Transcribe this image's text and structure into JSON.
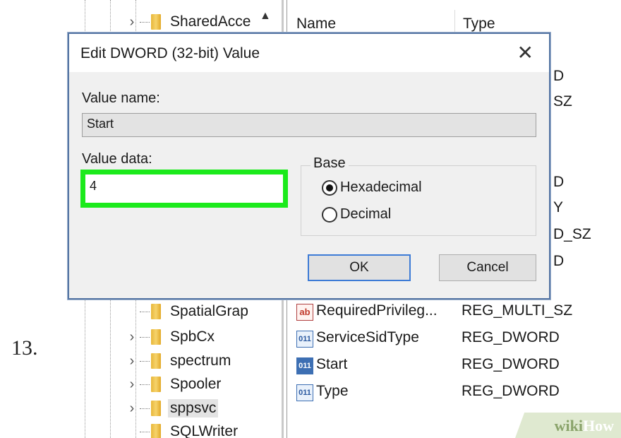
{
  "step_number": "13.",
  "tree": {
    "items": [
      {
        "label": "SharedAcce",
        "has_expander": true
      },
      {
        "label": "SpatialGrap",
        "has_expander": false
      },
      {
        "label": "SpbCx",
        "has_expander": true
      },
      {
        "label": "spectrum",
        "has_expander": true
      },
      {
        "label": "Spooler",
        "has_expander": true
      },
      {
        "label": "sppsvc",
        "has_expander": true,
        "selected": true
      },
      {
        "label": "SQLWriter",
        "has_expander": false
      }
    ],
    "scroll_up_icon": "chevron-up-icon"
  },
  "list": {
    "columns": {
      "name": "Name",
      "type": "Type"
    },
    "peek_types": [
      "D",
      "SZ",
      "D",
      "Y",
      "D_SZ",
      "D"
    ],
    "rows": [
      {
        "icon": "ab",
        "name": "RequiredPrivileg...",
        "type": "REG_MULTI_SZ"
      },
      {
        "icon": "011",
        "name": "ServiceSidType",
        "type": "REG_DWORD"
      },
      {
        "icon": "011",
        "name": "Start",
        "type": "REG_DWORD",
        "selected": true
      },
      {
        "icon": "011",
        "name": "Type",
        "type": "REG_DWORD"
      }
    ]
  },
  "dialog": {
    "title": "Edit DWORD (32-bit) Value",
    "close_glyph": "✕",
    "value_name_label": "Value name:",
    "value_name": "Start",
    "value_data_label": "Value data:",
    "value_data": "4",
    "base_label": "Base",
    "radio_hex": "Hexadecimal",
    "radio_dec": "Decimal",
    "selected_base": "Hexadecimal",
    "ok_label": "OK",
    "cancel_label": "Cancel",
    "highlight_color": "#1bea1b"
  },
  "watermark": {
    "wiki": "wiki",
    "how": "How"
  }
}
